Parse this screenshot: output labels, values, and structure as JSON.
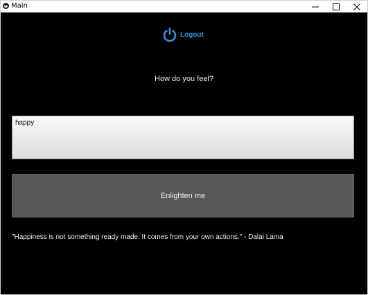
{
  "window": {
    "title": "Main",
    "icon": "kivy-icon",
    "controls": {
      "minimize_icon": "minimize-icon",
      "maximize_icon": "maximize-icon",
      "close_icon": "close-icon"
    }
  },
  "header": {
    "logout_label": "Logout",
    "logout_icon": "power-icon",
    "accent_color": "#3d8fd8"
  },
  "main": {
    "prompt": "How do you feel?",
    "feeling_input_value": "happy",
    "enlighten_label": "Enlighten me",
    "quote": "\"Happiness is not something ready made. It comes from your own actions.\" - Dalai Lama"
  },
  "colors": {
    "background": "#000000",
    "button": "#575757",
    "text": "#f0f0f0"
  }
}
